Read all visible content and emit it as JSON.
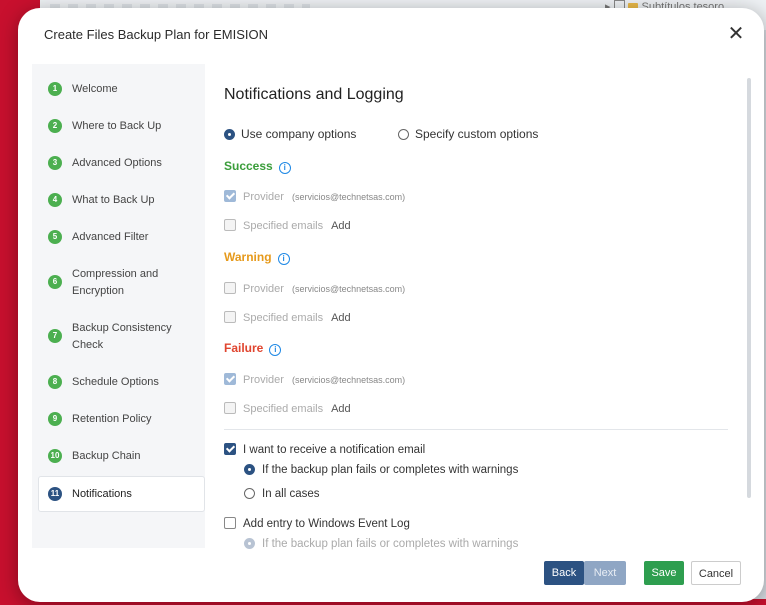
{
  "background": {
    "tree_label": "Subtítulos tesoro"
  },
  "dialog": {
    "title": "Create Files Backup Plan for EMISION",
    "close_glyph": "✕"
  },
  "sidebar": {
    "steps": [
      {
        "num": "1",
        "label": "Welcome"
      },
      {
        "num": "2",
        "label": "Where to Back Up"
      },
      {
        "num": "3",
        "label": "Advanced Options"
      },
      {
        "num": "4",
        "label": "What to Back Up"
      },
      {
        "num": "5",
        "label": "Advanced Filter"
      },
      {
        "num": "6",
        "label": "Compression and Encryption"
      },
      {
        "num": "7",
        "label": "Backup Consistency Check"
      },
      {
        "num": "8",
        "label": "Schedule Options"
      },
      {
        "num": "9",
        "label": "Retention Policy"
      },
      {
        "num": "10",
        "label": "Backup Chain"
      },
      {
        "num": "11",
        "label": "Notifications"
      }
    ],
    "active_step": "11"
  },
  "content": {
    "heading": "Notifications and Logging",
    "options": {
      "company": "Use company options",
      "custom": "Specify custom options",
      "selected": "company"
    },
    "success": {
      "title": "Success",
      "provider_label": "Provider",
      "provider_email": "(servicios@technetsas.com)",
      "provider_checked": true,
      "emails_label": "Specified emails",
      "add_label": "Add"
    },
    "warning": {
      "title": "Warning",
      "provider_label": "Provider",
      "provider_email": "(servicios@technetsas.com)",
      "provider_checked": false,
      "emails_label": "Specified emails",
      "add_label": "Add"
    },
    "failure": {
      "title": "Failure",
      "provider_label": "Provider",
      "provider_email": "(servicios@technetsas.com)",
      "provider_checked": true,
      "emails_label": "Specified emails",
      "add_label": "Add"
    },
    "notify_email": {
      "label": "I want to receive a notification email",
      "checked": true,
      "opt_fails": "If the backup plan fails or completes with warnings",
      "opt_all": "In all cases",
      "selected": "fails"
    },
    "event_log": {
      "label": "Add entry to Windows Event Log",
      "checked": false,
      "opt_fails": "If the backup plan fails or completes with warnings"
    }
  },
  "footer": {
    "back": "Back",
    "next": "Next",
    "save": "Save",
    "cancel": "Cancel"
  },
  "colors": {
    "success": "#3a9d3a",
    "warning": "#e69a1c",
    "failure": "#e0452f",
    "accent": "#2c5282",
    "step_done": "#4caf50",
    "save": "#2e9e4f",
    "brand_red": "#c8102e"
  }
}
